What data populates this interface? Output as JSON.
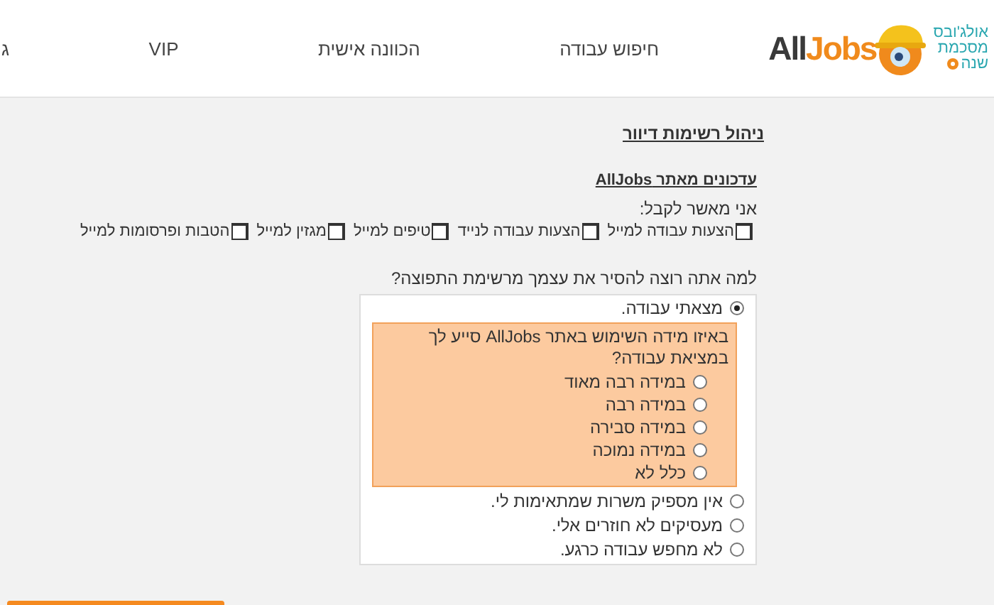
{
  "header": {
    "logo": {
      "brand_dark": "All",
      "brand_accent": "Jobs",
      "tagline": [
        "אולג'ובס",
        "מסכמת",
        "שנה"
      ]
    },
    "nav": [
      "חיפוש עבודה",
      "הכוונה אישית",
      "VIP",
      "ג"
    ]
  },
  "page_title": "ניהול רשימות דיוור",
  "section_title": "עדכונים מאתר AllJobs",
  "consent_label": "אני מאשר לקבל:",
  "subscriptions": [
    {
      "label": "הצעות עבודה למייל",
      "checked": false
    },
    {
      "label": "הצעות עבודה לנייד",
      "checked": false
    },
    {
      "label": "טיפים למייל",
      "checked": false
    },
    {
      "label": "מגזין למייל",
      "checked": false
    },
    {
      "label": "הטבות ופרסומות למייל",
      "checked": false
    }
  ],
  "question": "למה אתה רוצה להסיר את עצמך מרשימת התפוצה?",
  "reasons": [
    {
      "label": "מצאתי עבודה.",
      "selected": true,
      "followup": {
        "question": "באיזו מידה השימוש באתר AllJobs סייע לך במציאת עבודה?",
        "options": [
          {
            "label": "במידה רבה מאוד",
            "selected": false
          },
          {
            "label": "במידה רבה",
            "selected": false
          },
          {
            "label": "במידה סבירה",
            "selected": false
          },
          {
            "label": "במידה נמוכה",
            "selected": false
          },
          {
            "label": "כלל לא",
            "selected": false
          }
        ]
      }
    },
    {
      "label": "אין מספיק משרות שמתאימות לי.",
      "selected": false
    },
    {
      "label": "מעסיקים לא חוזרים אלי.",
      "selected": false
    },
    {
      "label": "לא מחפש עבודה כרגע.",
      "selected": false
    }
  ]
}
